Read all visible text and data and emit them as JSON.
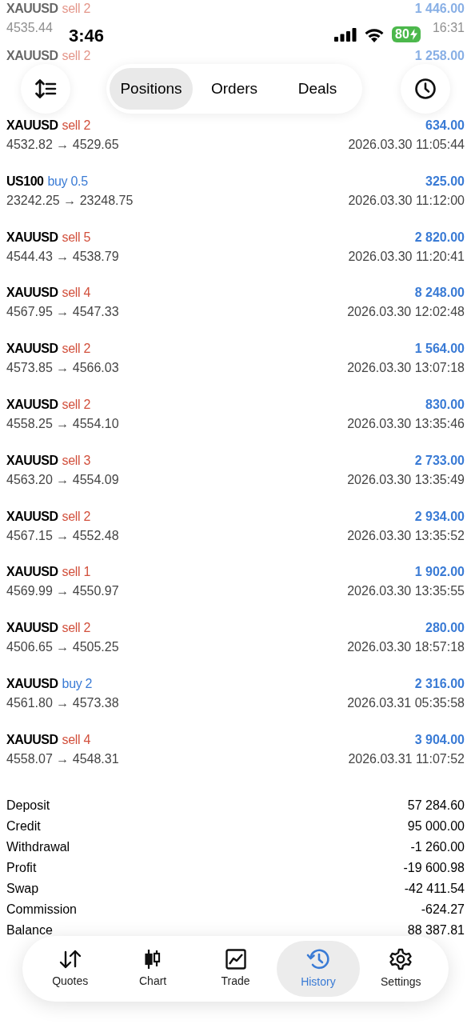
{
  "status_bar": {
    "time": "3:46",
    "battery": "80"
  },
  "header": {
    "tabs": [
      {
        "label": "Positions",
        "selected": true
      },
      {
        "label": "Orders",
        "selected": false
      },
      {
        "label": "Deals",
        "selected": false
      }
    ]
  },
  "deals": [
    {
      "symbol": "XAUUSD",
      "side": "sell 2",
      "kind": "sell",
      "profit": "1 446.00",
      "prices": "4535.44",
      "time": "16:31",
      "faded": true
    },
    {
      "symbol": "XAUUSD",
      "side": "sell 2",
      "kind": "sell",
      "profit": "1 258.00",
      "faded": true
    },
    {
      "symbol": "XAUUSD",
      "side": "sell 2",
      "kind": "sell",
      "profit": "634.00",
      "prices": "4532.82 → 4529.65",
      "time": "2026.03.30 11:05:44",
      "faded": false
    },
    {
      "symbol": "US100",
      "side": "buy 0.5",
      "kind": "buy",
      "profit": "325.00",
      "prices": "23242.25 → 23248.75",
      "time": "2026.03.30 11:12:00",
      "faded": false
    },
    {
      "symbol": "XAUUSD",
      "side": "sell 5",
      "kind": "sell",
      "profit": "2 820.00",
      "prices": "4544.43 → 4538.79",
      "time": "2026.03.30 11:20:41",
      "faded": false
    },
    {
      "symbol": "XAUUSD",
      "side": "sell 4",
      "kind": "sell",
      "profit": "8 248.00",
      "prices": "4567.95 → 4547.33",
      "time": "2026.03.30 12:02:48",
      "faded": false
    },
    {
      "symbol": "XAUUSD",
      "side": "sell 2",
      "kind": "sell",
      "profit": "1 564.00",
      "prices": "4573.85 → 4566.03",
      "time": "2026.03.30 13:07:18",
      "faded": false
    },
    {
      "symbol": "XAUUSD",
      "side": "sell 2",
      "kind": "sell",
      "profit": "830.00",
      "prices": "4558.25 → 4554.10",
      "time": "2026.03.30 13:35:46",
      "faded": false
    },
    {
      "symbol": "XAUUSD",
      "side": "sell 3",
      "kind": "sell",
      "profit": "2 733.00",
      "prices": "4563.20 → 4554.09",
      "time": "2026.03.30 13:35:49",
      "faded": false
    },
    {
      "symbol": "XAUUSD",
      "side": "sell 2",
      "kind": "sell",
      "profit": "2 934.00",
      "prices": "4567.15 → 4552.48",
      "time": "2026.03.30 13:35:52",
      "faded": false
    },
    {
      "symbol": "XAUUSD",
      "side": "sell 1",
      "kind": "sell",
      "profit": "1 902.00",
      "prices": "4569.99 → 4550.97",
      "time": "2026.03.30 13:35:55",
      "faded": false
    },
    {
      "symbol": "XAUUSD",
      "side": "sell 2",
      "kind": "sell",
      "profit": "280.00",
      "prices": "4506.65 → 4505.25",
      "time": "2026.03.30 18:57:18",
      "faded": false
    },
    {
      "symbol": "XAUUSD",
      "side": "buy 2",
      "kind": "buy",
      "profit": "2 316.00",
      "prices": "4561.80 → 4573.38",
      "time": "2026.03.31 05:35:58",
      "faded": false
    },
    {
      "symbol": "XAUUSD",
      "side": "sell 4",
      "kind": "sell",
      "profit": "3 904.00",
      "prices": "4558.07 → 4548.31",
      "time": "2026.03.31 11:07:52",
      "faded": false
    }
  ],
  "summary": [
    {
      "label": "Deposit",
      "value": "57 284.60"
    },
    {
      "label": "Credit",
      "value": "95 000.00"
    },
    {
      "label": "Withdrawal",
      "value": "-1 260.00"
    },
    {
      "label": "Profit",
      "value": "-19 600.98"
    },
    {
      "label": "Swap",
      "value": "-42 411.54"
    },
    {
      "label": "Commission",
      "value": "-624.27"
    },
    {
      "label": "Balance",
      "value": "88 387.81"
    }
  ],
  "nav": [
    {
      "label": "Quotes",
      "selected": false
    },
    {
      "label": "Chart",
      "selected": false
    },
    {
      "label": "Trade",
      "selected": false
    },
    {
      "label": "History",
      "selected": true
    },
    {
      "label": "Settings",
      "selected": false
    }
  ]
}
